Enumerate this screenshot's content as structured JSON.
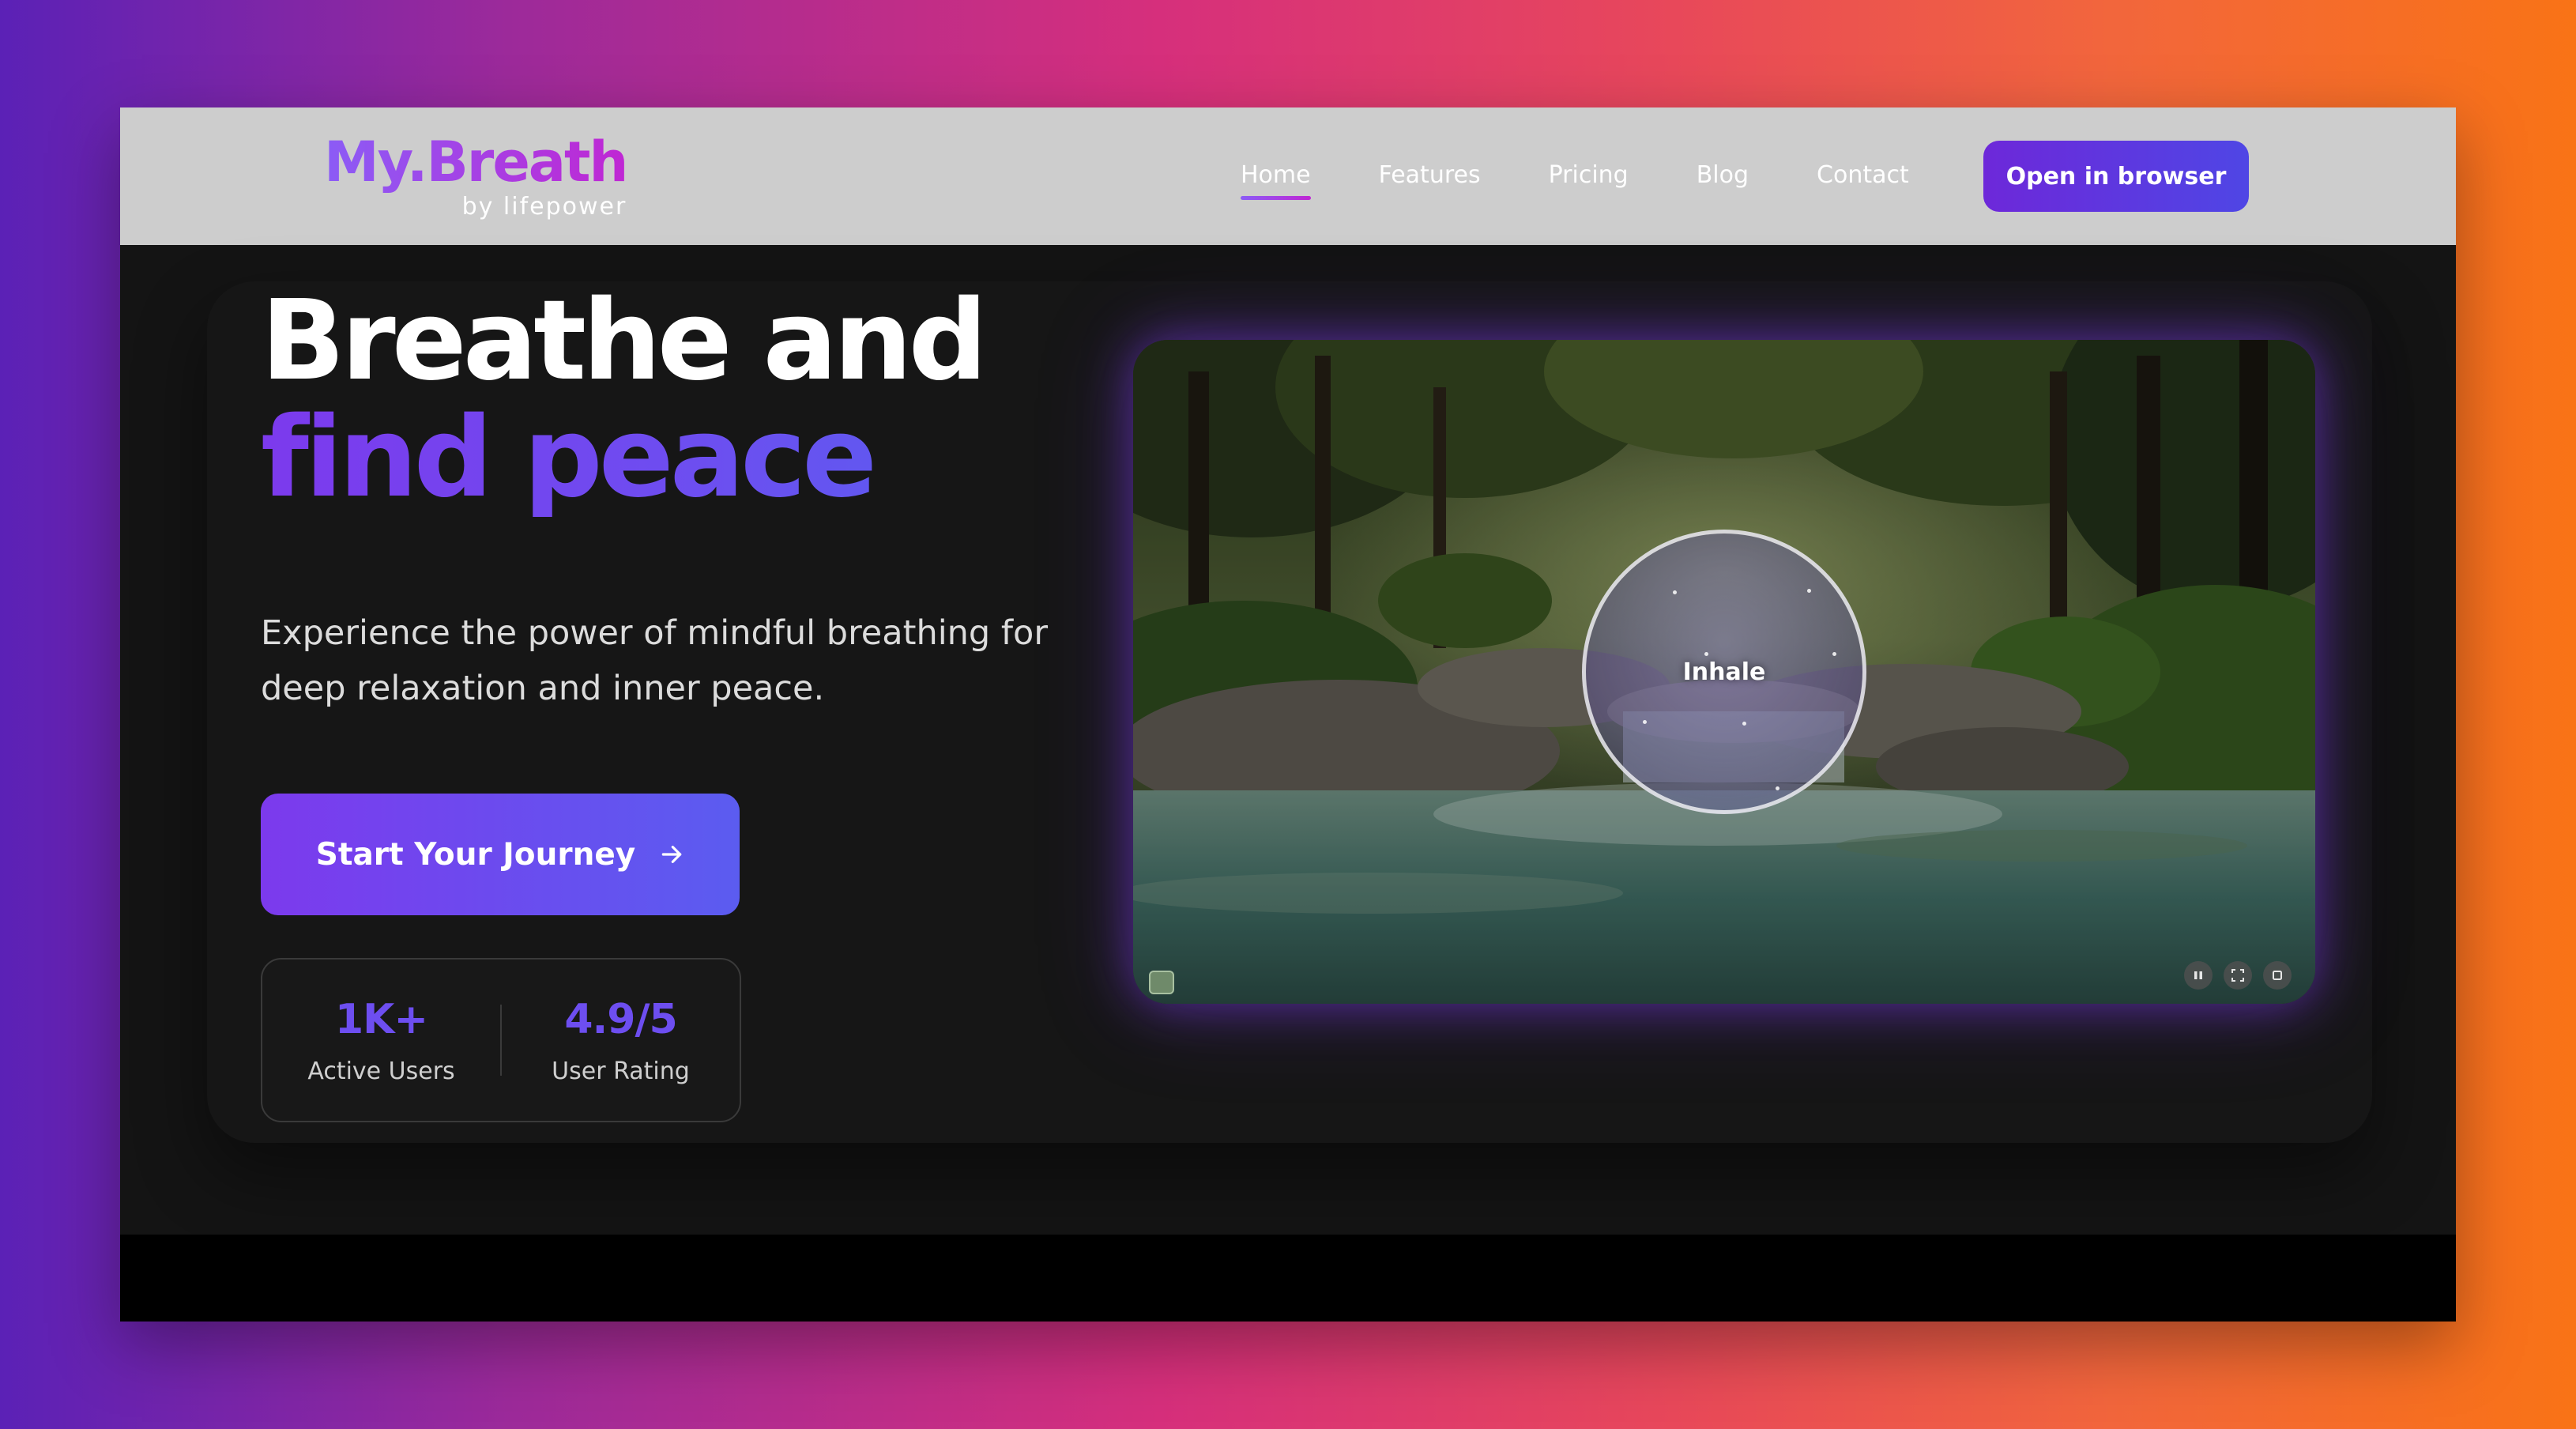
{
  "brand": {
    "name": "My.Breath",
    "tagline": "by lifepower"
  },
  "nav": {
    "items": [
      {
        "label": "Home",
        "active": true
      },
      {
        "label": "Features",
        "active": false
      },
      {
        "label": "Pricing",
        "active": false
      },
      {
        "label": "Blog",
        "active": false
      },
      {
        "label": "Contact",
        "active": false
      }
    ],
    "cta_label": "Open in browser"
  },
  "hero": {
    "headline_line1": "Breathe and",
    "headline_line2": "find peace",
    "description": "Experience the power of mindful breathing for deep relaxation and inner peace.",
    "cta_label": "Start Your Journey",
    "cta_icon": "arrow-right-icon",
    "stats": [
      {
        "value": "1K+",
        "label": "Active Users"
      },
      {
        "value": "4.9/5",
        "label": "User Rating"
      }
    ]
  },
  "media": {
    "breath_phase": "Inhale",
    "controls": [
      "pause-icon",
      "fullscreen-icon",
      "stop-icon"
    ],
    "corner_icon": "music-icon"
  },
  "colors": {
    "accent": "#6d4ef0",
    "accent_violet": "#7c3aed",
    "nav_bg": "#cdcdcd",
    "page_bg": "#141414"
  }
}
